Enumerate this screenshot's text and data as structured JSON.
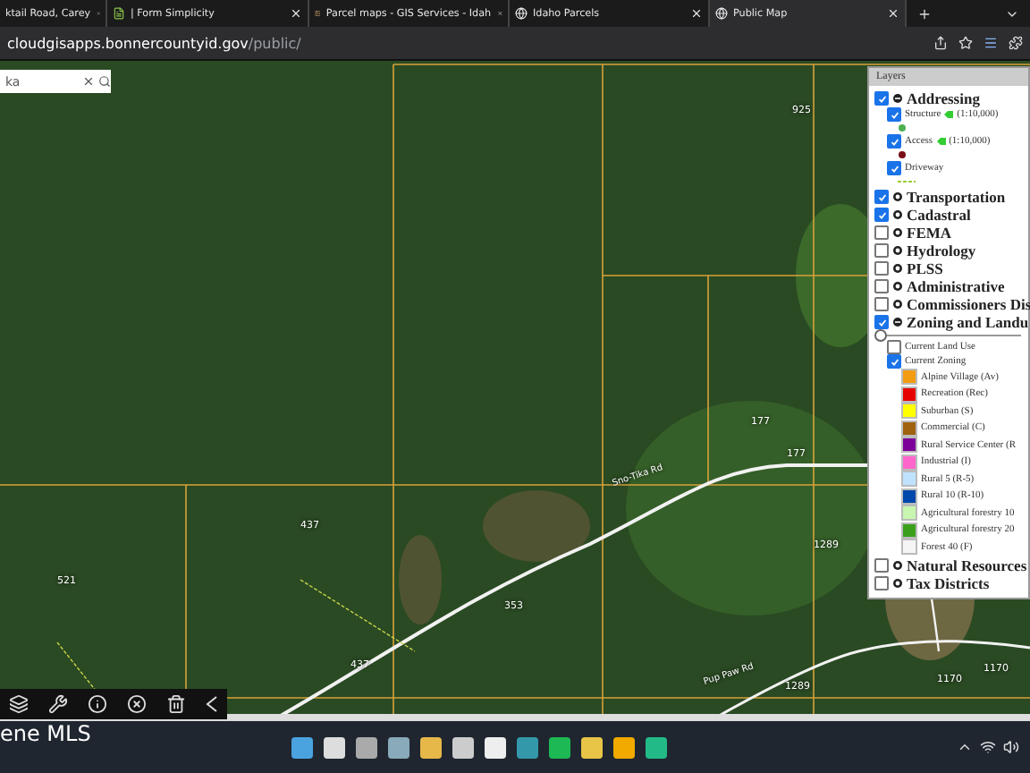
{
  "browser": {
    "tabs": [
      {
        "title": "ktail Road, Carey",
        "selected": false,
        "kind": "page"
      },
      {
        "title": "| Form Simplicity",
        "selected": false,
        "kind": "doc"
      },
      {
        "title": "Parcel maps - GIS Services - Idah",
        "selected": false,
        "kind": "photo"
      },
      {
        "title": "Idaho Parcels",
        "selected": false,
        "kind": "globe"
      },
      {
        "title": "Public Map",
        "selected": true,
        "kind": "globe"
      }
    ],
    "address": {
      "host": "cloudgisapps.bonnercountyid.gov",
      "path": "/public/"
    }
  },
  "map": {
    "search": {
      "value": "ka"
    },
    "labels": [
      {
        "text": "925",
        "kind": "address"
      },
      {
        "text": "177",
        "kind": "address"
      },
      {
        "text": "177",
        "kind": "address"
      },
      {
        "text": "Sno-Tika Rd",
        "kind": "road"
      },
      {
        "text": "437",
        "kind": "address"
      },
      {
        "text": "353",
        "kind": "address"
      },
      {
        "text": "1289",
        "kind": "address"
      },
      {
        "text": "521",
        "kind": "address"
      },
      {
        "text": "437",
        "kind": "address"
      },
      {
        "text": "Pup Paw Rd",
        "kind": "road"
      },
      {
        "text": "1289",
        "kind": "address"
      },
      {
        "text": "1170",
        "kind": "address"
      },
      {
        "text": "1170",
        "kind": "address"
      }
    ],
    "layers": {
      "title": "Layers",
      "groups": [
        {
          "label": "Addressing",
          "checked": true,
          "expanded": true,
          "children": [
            {
              "label": "Structure",
              "scale": "(1:10,000)",
              "checked": true,
              "color": "#4caf50",
              "kind": "point"
            },
            {
              "label": "Access",
              "scale": "(1:10,000)",
              "checked": true,
              "color": "#7a0f1a",
              "kind": "point"
            },
            {
              "label": "Driveway",
              "checked": true,
              "color": "#9acd32",
              "kind": "line"
            }
          ]
        },
        {
          "label": "Transportation",
          "checked": true,
          "expanded": false
        },
        {
          "label": "Cadastral",
          "checked": true,
          "expanded": false
        },
        {
          "label": "FEMA",
          "checked": false,
          "expanded": false
        },
        {
          "label": "Hydrology",
          "checked": false,
          "expanded": false
        },
        {
          "label": "PLSS",
          "checked": false,
          "expanded": false
        },
        {
          "label": "Administrative",
          "checked": false,
          "expanded": false
        },
        {
          "label": "Commissioners Dis",
          "checked": false,
          "expanded": false
        },
        {
          "label": "Zoning and Landu",
          "checked": true,
          "expanded": true,
          "opacity": {
            "level": 0
          },
          "children": [
            {
              "label": "Current Land Use",
              "checked": false
            },
            {
              "label": "Current Zoning",
              "checked": true,
              "legend": [
                {
                  "label": "Alpine Village (Av)",
                  "color": "#f39c12"
                },
                {
                  "label": "Recreation (Rec)",
                  "color": "#e60000"
                },
                {
                  "label": "Suburban (S)",
                  "color": "#ffff00"
                },
                {
                  "label": "Commercial (C)",
                  "color": "#a0620f"
                },
                {
                  "label": "Rural Service Center (R",
                  "color": "#7b0099"
                },
                {
                  "label": "Industrial (I)",
                  "color": "#ff66cc"
                },
                {
                  "label": "Rural 5 (R-5)",
                  "color": "#bfe3ff"
                },
                {
                  "label": "Rural 10 (R-10)",
                  "color": "#0047ab"
                },
                {
                  "label": "Agricultural forestry 10",
                  "color": "#c8f5b0"
                },
                {
                  "label": "Agricultural forestry 20",
                  "color": "#3aa01a"
                },
                {
                  "label": "Forest 40 (F)",
                  "color": "#f5f5f5"
                }
              ]
            }
          ]
        },
        {
          "label": "Natural Resources",
          "checked": false,
          "expanded": false
        },
        {
          "label": "Tax Districts",
          "checked": false,
          "expanded": false
        }
      ]
    }
  },
  "overlay_text": "ene MLS"
}
